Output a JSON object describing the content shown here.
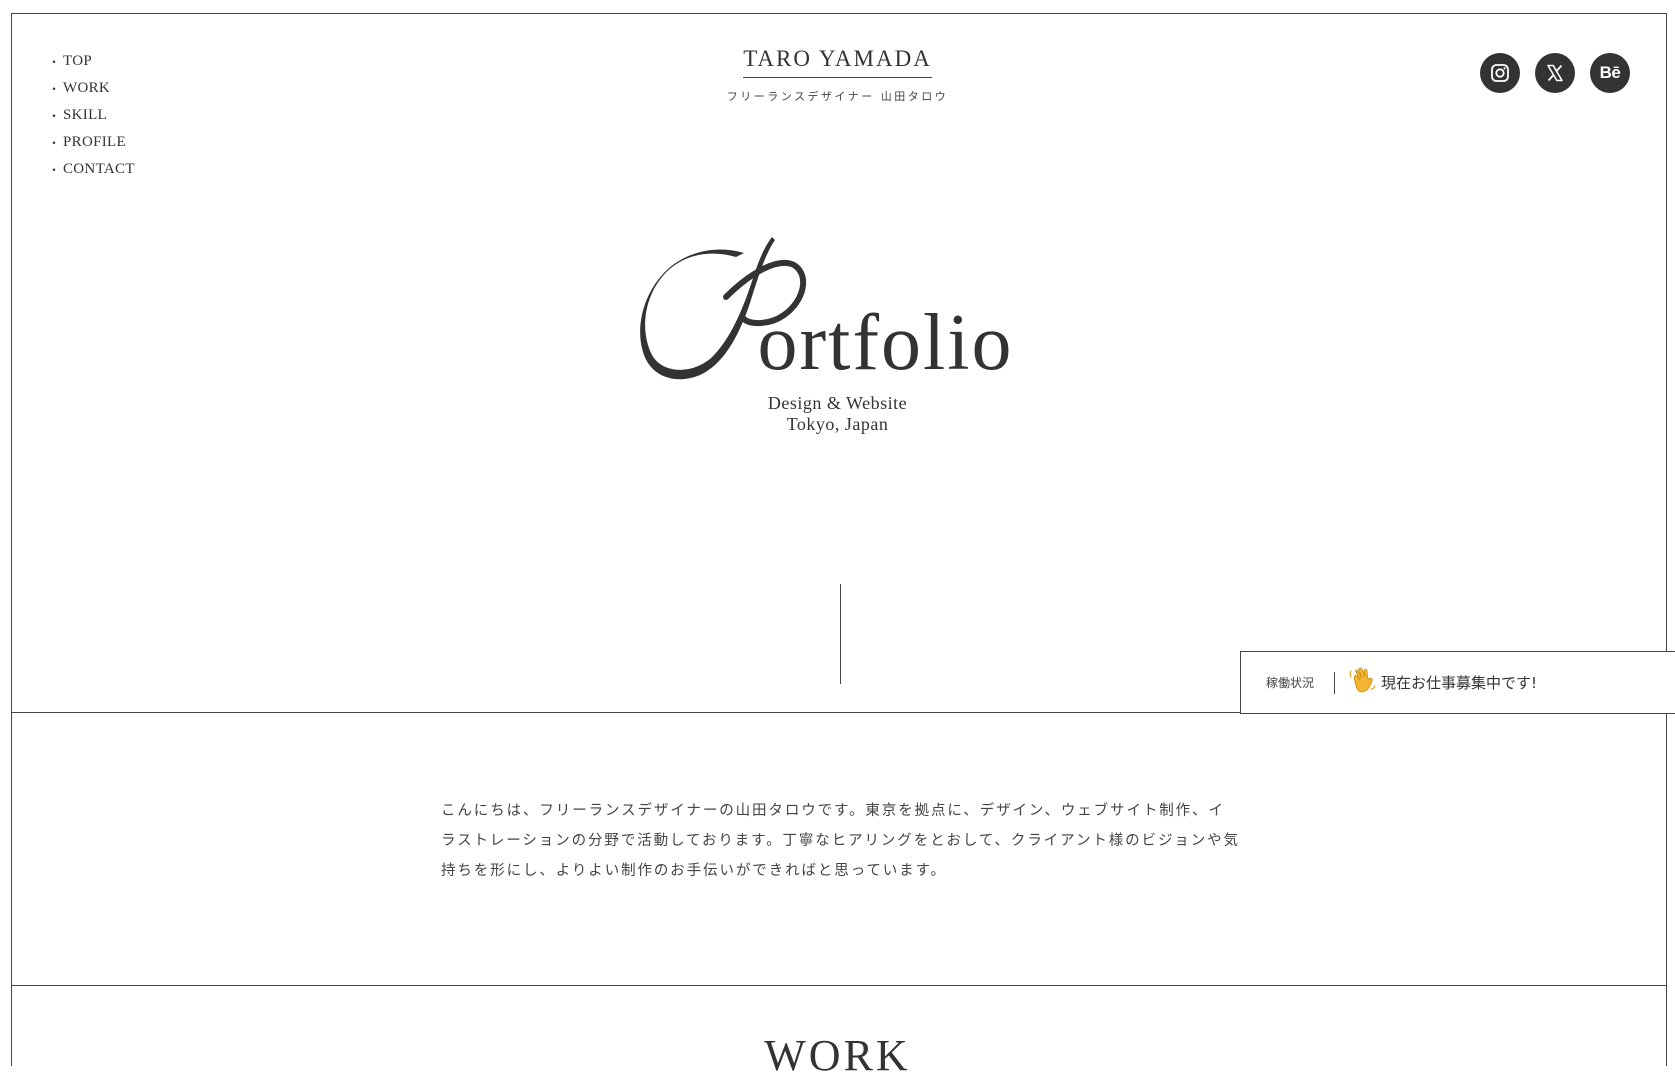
{
  "nav": {
    "items": [
      {
        "label": "TOP"
      },
      {
        "label": "WORK"
      },
      {
        "label": "SKILL"
      },
      {
        "label": "PROFILE"
      },
      {
        "label": "CONTACT"
      }
    ],
    "bullet": "・"
  },
  "brand": {
    "name": "TARO YAMADA",
    "subtitle": "フリーランスデザイナー 山田タロウ"
  },
  "social": {
    "items": [
      {
        "name": "instagram-icon"
      },
      {
        "name": "x-icon"
      },
      {
        "name": "behance-icon",
        "label": "Bē"
      }
    ]
  },
  "hero": {
    "title_rest": "ortfolio",
    "line1": "Design & Website",
    "line2": "Tokyo, Japan"
  },
  "status": {
    "label": "稼働状況",
    "icon": "waving-hand-icon",
    "text": "現在お仕事募集中です!"
  },
  "intro": {
    "text": "こんにちは、フリーランスデザイナーの山田タロウです。東京を拠点に、デザイン、ウェブサイト制作、イラストレーションの分野で活動しております。丁寧なヒアリングをとおして、クライアント様のビジョンや気持ちを形にし、よりよい制作のお手伝いができればと思っています。"
  },
  "work": {
    "heading": "WORK"
  },
  "colors": {
    "text": "#333333",
    "border": "#444444",
    "background": "#ffffff",
    "emoji": "#f2b632"
  }
}
